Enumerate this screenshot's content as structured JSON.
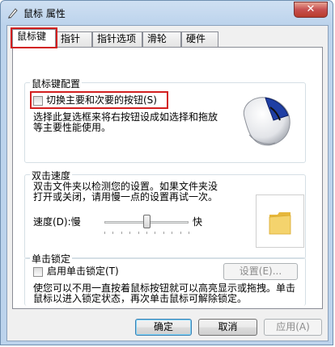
{
  "window": {
    "title": "鼠标 属性",
    "close_glyph": "✕"
  },
  "tabs": [
    {
      "label": "鼠标键",
      "active": true
    },
    {
      "label": "指针",
      "active": false
    },
    {
      "label": "指针选项",
      "active": false
    },
    {
      "label": "滑轮",
      "active": false
    },
    {
      "label": "硬件",
      "active": false
    }
  ],
  "button_config": {
    "group_label": "鼠标键配置",
    "switch_checkbox_label": "切换主要和次要的按钮(S)",
    "switch_checked": false,
    "description": [
      "选择此复选框来将右按钮设成如选择和拖放",
      "等主要性能使用。"
    ]
  },
  "double_click": {
    "group_label": "双击速度",
    "description": [
      "双击文件夹以检测您的设置。如果文件夹没",
      "打开或关闭，请用慢一点的设置再试一次。"
    ],
    "speed_label": "速度(D):慢",
    "speed_fast": "快",
    "speed_value_fraction": 0.5
  },
  "click_lock": {
    "group_label": "单击锁定",
    "checkbox_label": "启用单击锁定(T)",
    "checked": false,
    "settings_button": "设置(E)...",
    "description": [
      "使您可以不用一直按着鼠标按钮就可以高亮显示或拖拽。单击",
      "鼠标以进入锁定状态，再次单击鼠标可解除锁定。"
    ]
  },
  "footer": {
    "ok": "确定",
    "cancel": "取消",
    "apply": "应用(A)"
  },
  "colors": {
    "highlight_box": "#d21f1f",
    "folder": "#f1c64b"
  },
  "icons": [
    "mouse-properties-icon",
    "close-icon",
    "mouse-image",
    "folder-icon"
  ]
}
